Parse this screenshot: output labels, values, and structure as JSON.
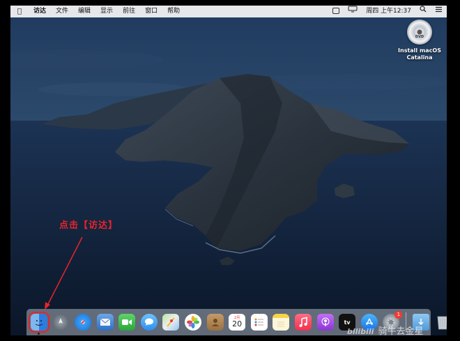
{
  "menubar": {
    "apple_icon": "apple-icon",
    "app_name": "访达",
    "menus": [
      "文件",
      "编辑",
      "显示",
      "前往",
      "窗口",
      "帮助"
    ],
    "status": {
      "clock": "周四 上午12:37",
      "items": [
        "keyboard-icon",
        "display-icon",
        "search-icon",
        "control-center-icon"
      ]
    }
  },
  "desktop": {
    "disc_icon_text": "DVD",
    "installer_label_line1": "Install macOS",
    "installer_label_line2": "Catalina"
  },
  "annotation": {
    "text": "点击【访达】",
    "color": "#e8242b"
  },
  "dock": {
    "apps": [
      "finder-icon",
      "launchpad-icon",
      "safari-icon",
      "mail-icon",
      "facetime-icon",
      "messages-icon",
      "maps-icon",
      "photos-icon",
      "contacts-icon",
      "calendar-icon",
      "reminders-icon",
      "notes-icon",
      "music-icon",
      "podcasts-icon",
      "tv-icon",
      "app-store-icon",
      "system-preferences-icon"
    ],
    "calendar_day": "20",
    "calendar_month": "2月",
    "tv_label": "tv",
    "system_preferences_badge": "1",
    "right_items": [
      "downloads-folder-icon",
      "trash-icon"
    ]
  },
  "watermark": {
    "brand": "bilibili",
    "text": "骑牛去金星"
  }
}
